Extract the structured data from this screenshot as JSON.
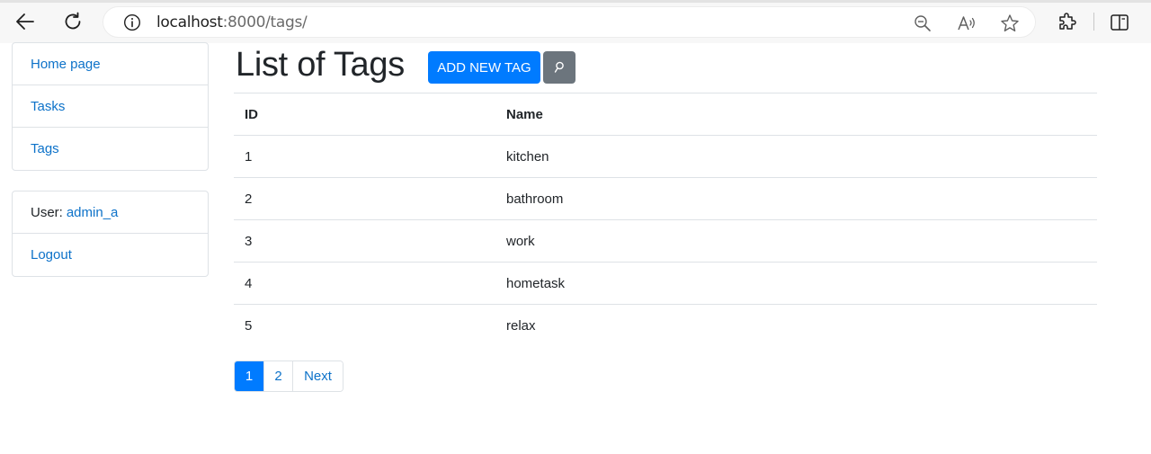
{
  "browser": {
    "url_host": "localhost",
    "url_rest": ":8000/tags/",
    "icons": [
      "back-icon",
      "reload-icon",
      "site-info-icon",
      "zoom-out-icon",
      "read-aloud-icon",
      "favorite-star-icon",
      "extensions-icon",
      "split-screen-icon"
    ]
  },
  "sidebar": {
    "nav": [
      {
        "label": "Home page"
      },
      {
        "label": "Tasks"
      },
      {
        "label": "Tags"
      }
    ],
    "user": {
      "prefix": "User:",
      "username": "admin_a",
      "logout": "Logout"
    }
  },
  "main": {
    "title": "List of Tags",
    "add_button": "ADD NEW TAG",
    "search_icon": "⌕",
    "table": {
      "headers": [
        "ID",
        "Name"
      ],
      "rows": [
        {
          "id": "1",
          "name": "kitchen"
        },
        {
          "id": "2",
          "name": "bathroom"
        },
        {
          "id": "3",
          "name": "work"
        },
        {
          "id": "4",
          "name": "hometask"
        },
        {
          "id": "5",
          "name": "relax"
        }
      ]
    },
    "pagination": {
      "pages": [
        "1",
        "2"
      ],
      "next": "Next",
      "active": "1"
    }
  },
  "colors": {
    "primary": "#007bff",
    "secondary": "#6c757d",
    "link": "#0d72c9",
    "border": "#dee2e6"
  }
}
